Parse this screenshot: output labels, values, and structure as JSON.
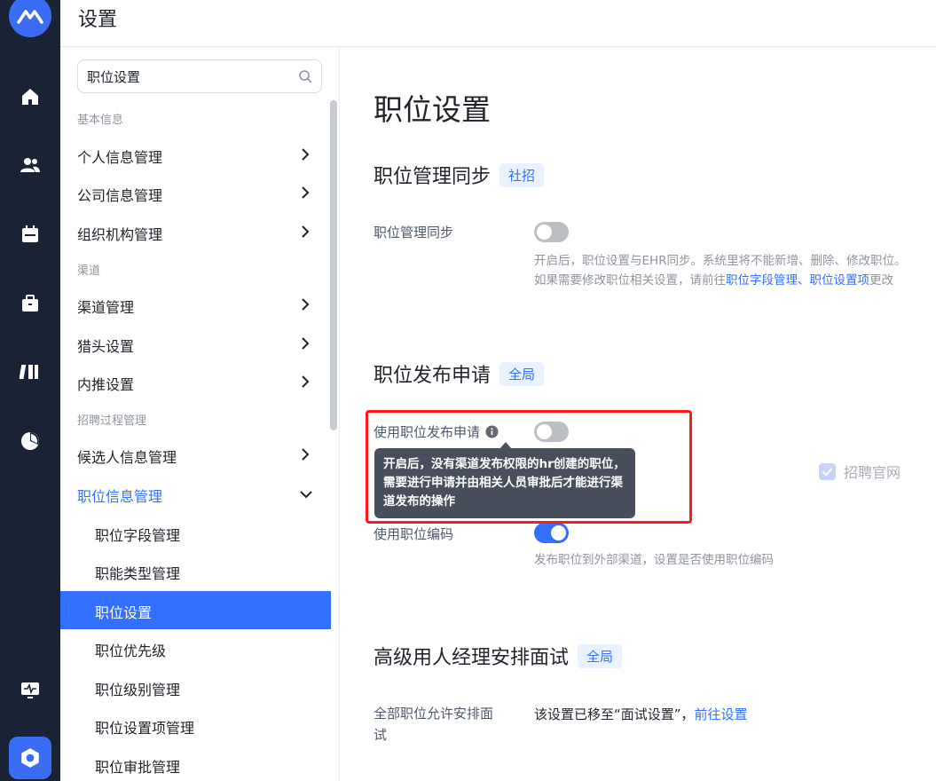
{
  "header": {
    "title": "设置"
  },
  "search": {
    "value": "职位设置",
    "placeholder": ""
  },
  "nav": {
    "group_basic": "基本信息",
    "personal": "个人信息管理",
    "company": "公司信息管理",
    "org": "组织机构管理",
    "group_channel": "渠道",
    "channel_mgmt": "渠道管理",
    "headhunter": "猎头设置",
    "referral": "内推设置",
    "group_process": "招聘过程管理",
    "candidate": "候选人信息管理",
    "position_info": "职位信息管理",
    "field_mgmt": "职位字段管理",
    "function_type": "职能类型管理",
    "position_settings": "职位设置",
    "priority": "职位优先级",
    "level": "职位级别管理",
    "setting_items": "职位设置项管理",
    "approval": "职位审批管理"
  },
  "content": {
    "page_title": "职位设置",
    "sync": {
      "title": "职位管理同步",
      "tag": "社招",
      "label": "职位管理同步",
      "enabled": false,
      "desc_line1": "开启后，职位设置与EHR同步。系统里将不能新增、删除、修改职位。",
      "desc_line2_prefix": "如果需要修改职位相关设置，请前往",
      "desc_link1": "职位字段管理",
      "desc_sep": "、",
      "desc_link2": "职位设置项",
      "desc_suffix": "更改"
    },
    "publish": {
      "title": "职位发布申请",
      "tag": "全局",
      "label": "使用职位发布申请",
      "enabled": false,
      "tooltip": "开启后，没有渠道发布权限的hr创建的职位，需要进行申请并由相关人员审批后才能进行渠道发布的操作",
      "checkbox_label": "招聘官网",
      "code_label": "使用职位编码",
      "code_enabled": true,
      "code_desc": "发布职位到外部渠道，设置是否使用职位编码"
    },
    "interview": {
      "title": "高级用人经理安排面试",
      "tag": "全局",
      "label_line1": "全部职位允许安排面",
      "label_line2": "试",
      "text": "该设置已移至“面试设置”，",
      "link": "前往设置"
    }
  },
  "colors": {
    "rail": "#1a2235",
    "accent": "#3370ff",
    "toggle_off": "#bbbfc4",
    "highlight": "#ff1a1a"
  }
}
